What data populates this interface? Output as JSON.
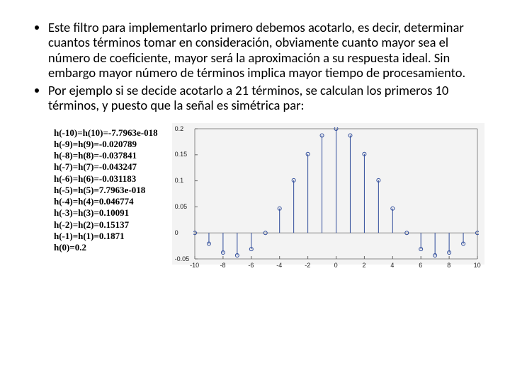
{
  "bullets": [
    "Este filtro para implementarlo primero debemos acotarlo, es decir, determinar cuantos términos tomar en consideración, obviamente cuanto mayor sea el número de coeficiente, mayor será la aproximación a su respuesta ideal. Sin embargo mayor número de términos implica mayor tiempo de procesamiento.",
    "Por ejemplo si se decide acotarlo a 21 términos, se calculan los primeros 10 términos, y puesto que la señal es simétrica par:"
  ],
  "hlines": [
    "h(-10)=h(10)=-7.7963e-018",
    "h(-9)=h(9)=-0.020789",
    "h(-8)=h(8)=-0.037841",
    "h(-7)=h(7)=-0.043247",
    "h(-6)=h(6)=-0.031183",
    "h(-5)=h(5)=7.7963e-018",
    "h(-4)=h(4)=0.046774",
    "h(-3)=h(3)=0.10091",
    "h(-2)=h(2)=0.15137",
    "h(-1)=h(1)=0.1871",
    "h(0)=0.2"
  ],
  "chart_data": {
    "type": "bar",
    "title": "",
    "xlabel": "",
    "ylabel": "",
    "categories": [
      -10,
      -9,
      -8,
      -7,
      -6,
      -5,
      -4,
      -3,
      -2,
      -1,
      0,
      1,
      2,
      3,
      4,
      5,
      6,
      7,
      8,
      9,
      10
    ],
    "values": [
      0,
      -0.020789,
      -0.037841,
      -0.043247,
      -0.031183,
      0,
      0.046774,
      0.10091,
      0.15137,
      0.1871,
      0.2,
      0.1871,
      0.15137,
      0.10091,
      0.046774,
      0,
      -0.031183,
      -0.043247,
      -0.037841,
      -0.020789,
      0
    ],
    "ylim": [
      -0.05,
      0.2
    ],
    "yticks": [
      -0.05,
      0,
      0.05,
      0.1,
      0.15,
      0.2
    ],
    "xticks": [
      -10,
      -8,
      -6,
      -4,
      -2,
      0,
      2,
      4,
      6,
      8,
      10
    ]
  }
}
